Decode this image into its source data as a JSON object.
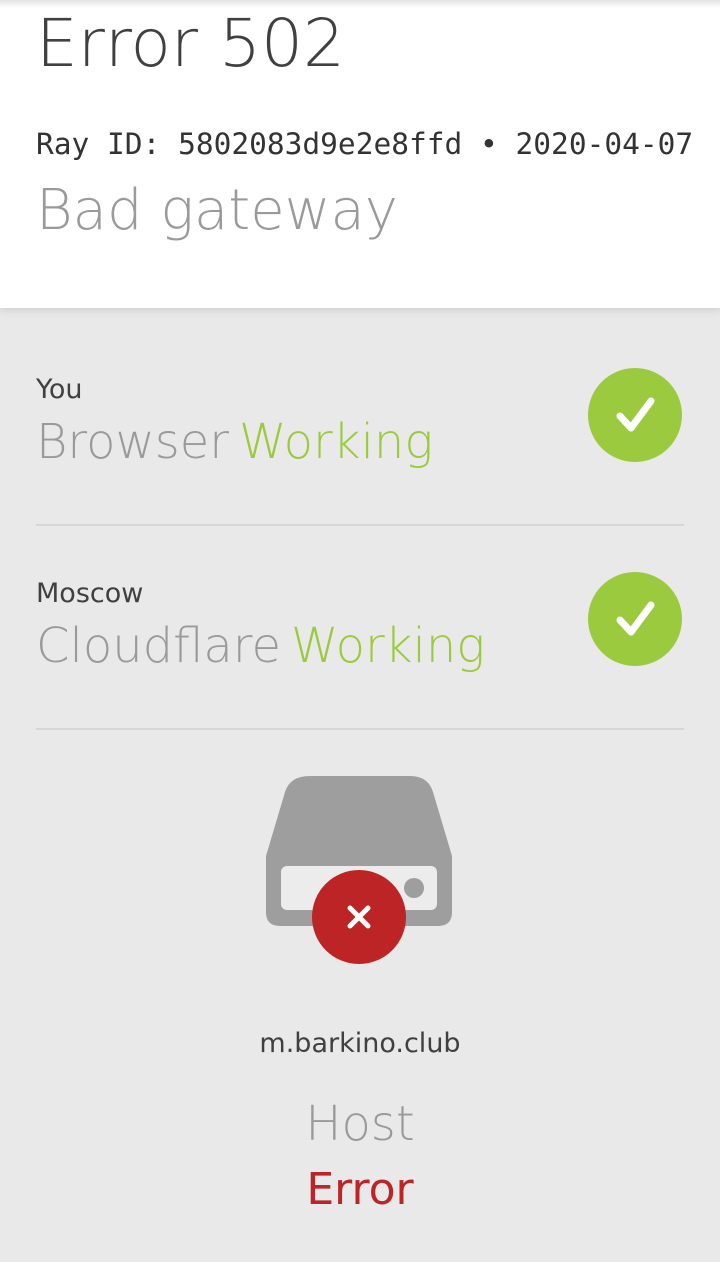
{
  "header": {
    "title": "Error 502",
    "ray_line": "Ray ID: 5802083d9e2e8ffd • 2020-04-07",
    "subtitle": "Bad gateway"
  },
  "statuses": [
    {
      "location": "You",
      "name": "Browser",
      "status": "Working",
      "icon": "check-icon"
    },
    {
      "location": "Moscow",
      "name": "Cloudflare",
      "status": "Working",
      "icon": "check-icon"
    }
  ],
  "host": {
    "domain": "m.barkino.club",
    "name": "Host",
    "status": "Error",
    "icon": "server-icon",
    "badge_icon": "error-x-icon"
  },
  "colors": {
    "working": "#9bca3e",
    "error": "#bd2426",
    "muted_text": "#9a9a9a",
    "server_gray": "#9e9e9e"
  }
}
